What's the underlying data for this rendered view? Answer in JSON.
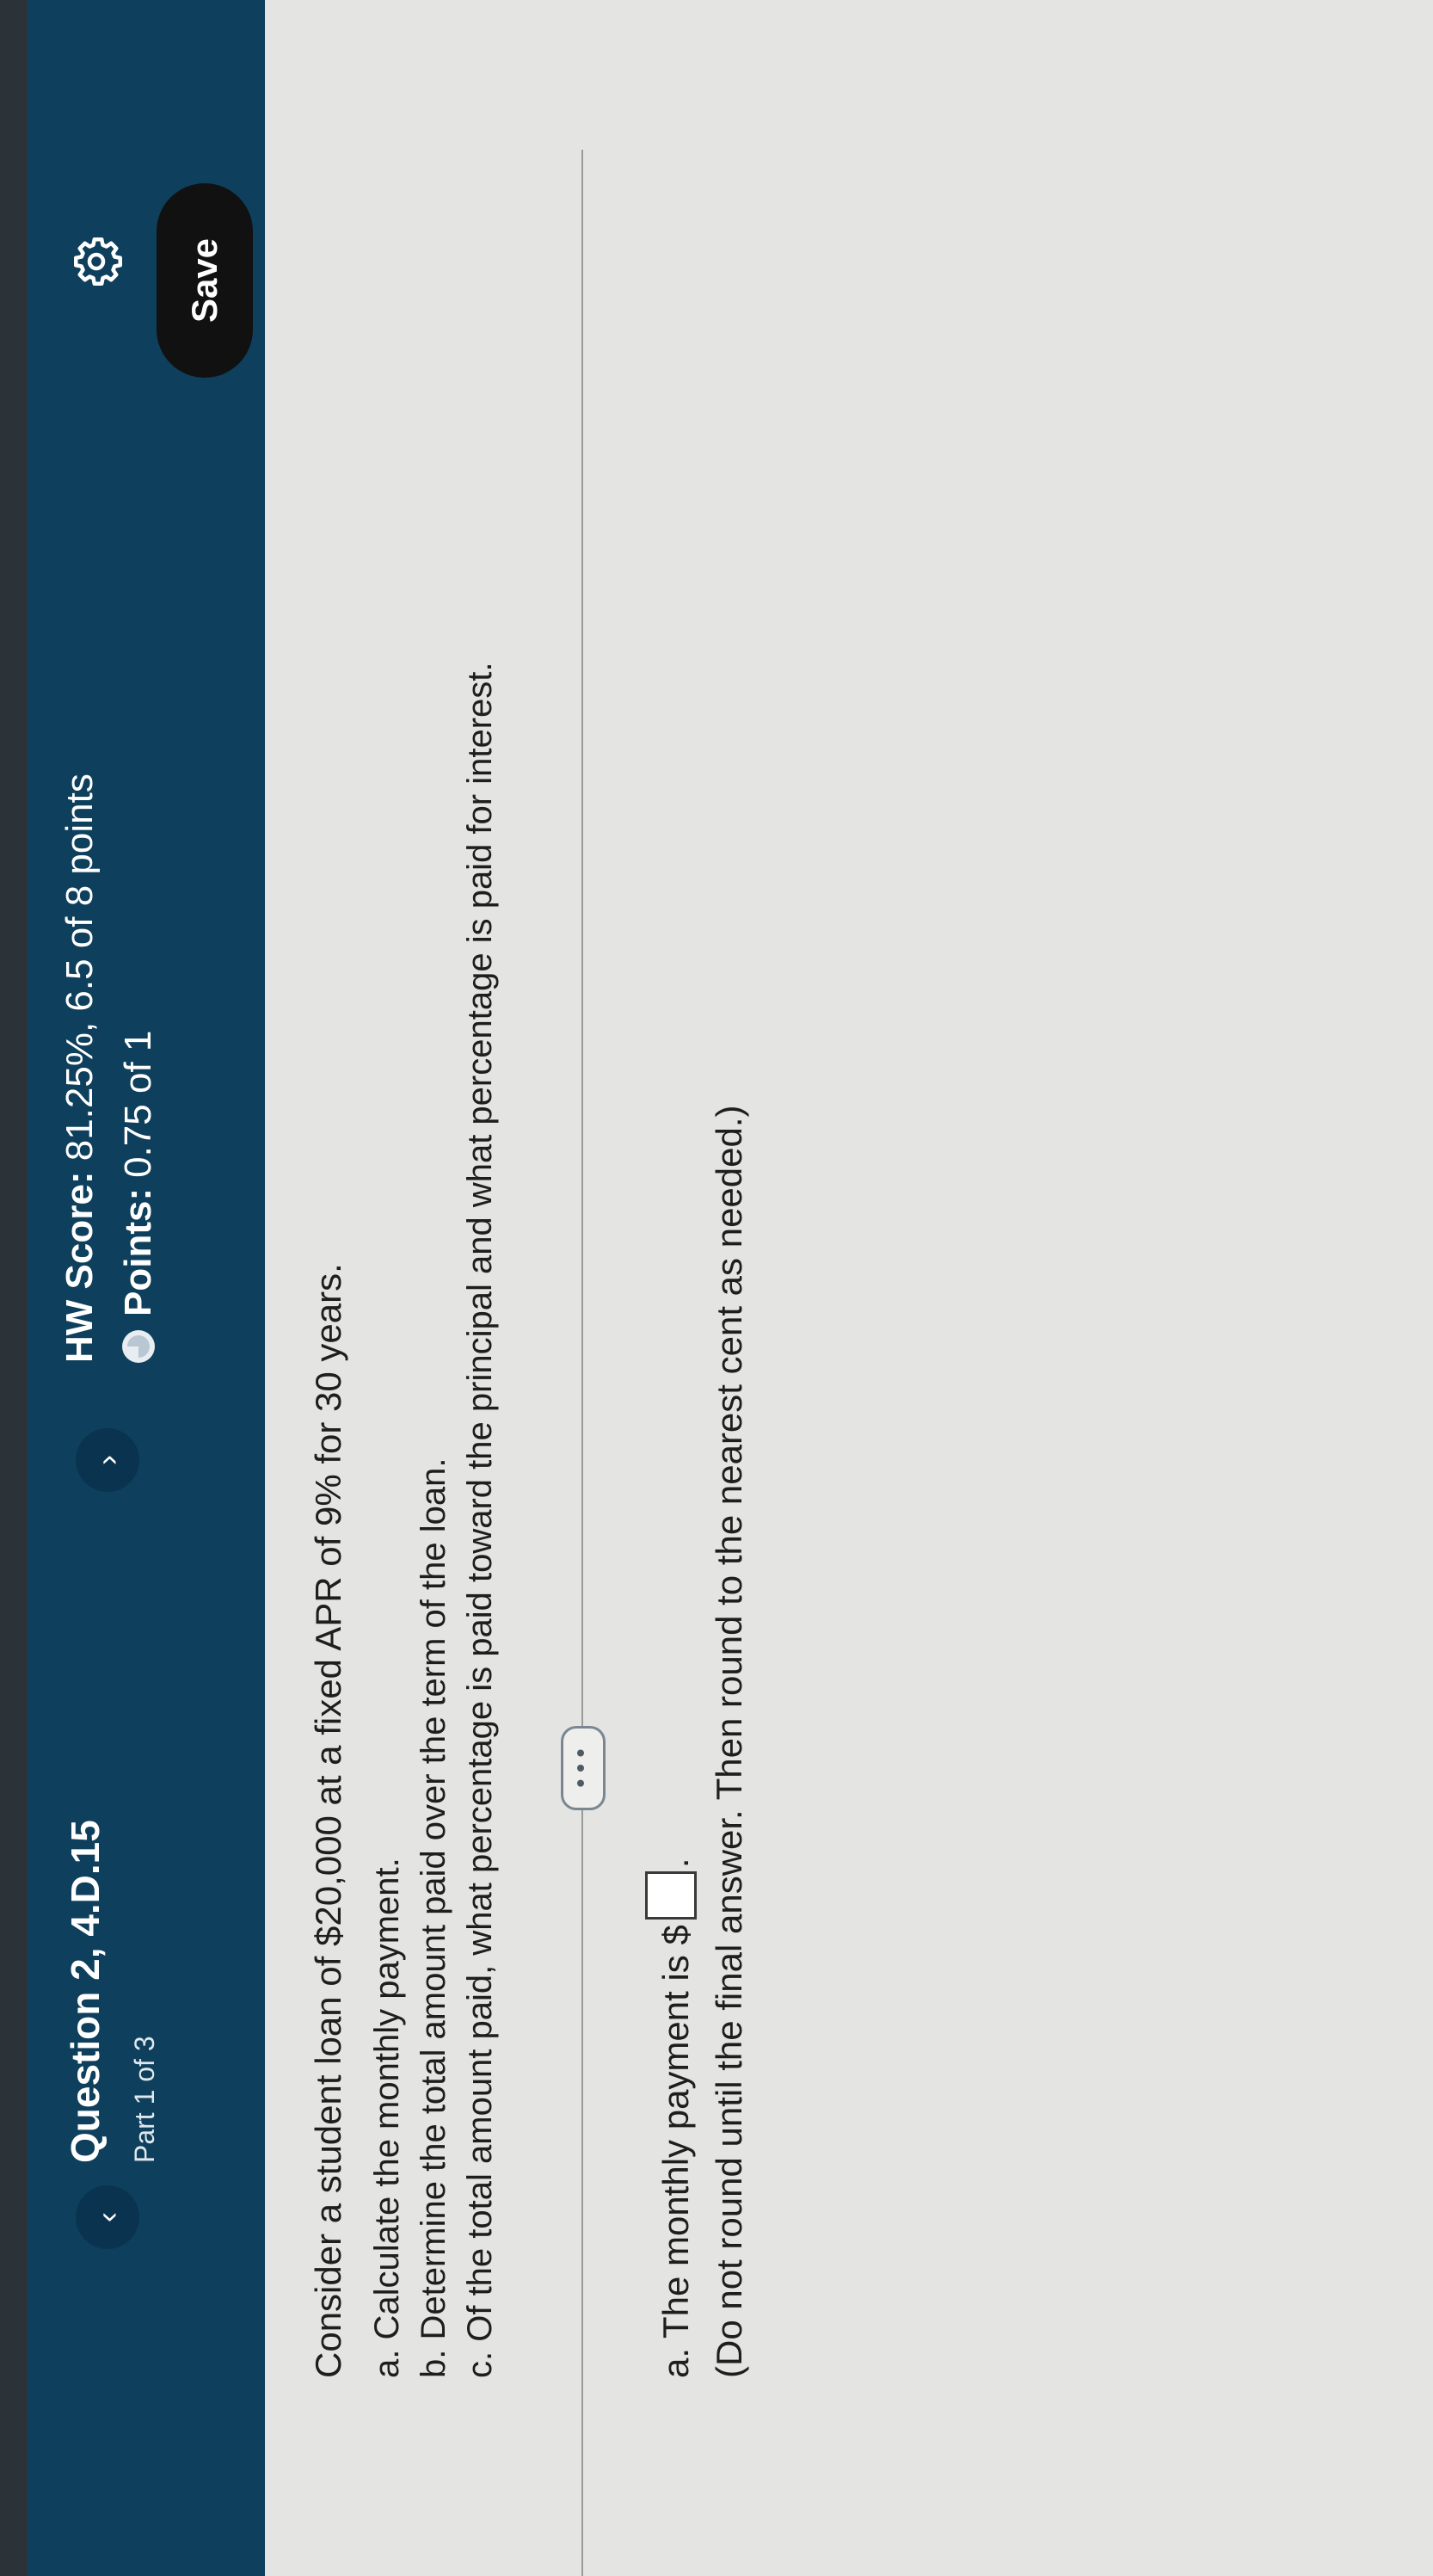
{
  "header": {
    "prev_icon": "chevron-left-icon",
    "next_icon": "chevron-right-icon",
    "prev_glyph": "‹",
    "next_glyph": "›",
    "question_title": "Question 2, 4.D.15",
    "part_label": "Part 1 of 3",
    "hw_score_label": "HW Score:",
    "hw_score_value": "81.25%, 6.5 of 8 points",
    "points_label": "Points:",
    "points_value": "0.75 of 1",
    "points_icon": "partial-credit-icon",
    "save_label": "Save",
    "settings_icon": "gear-icon",
    "colors": {
      "header_bg": "#0e3f5c",
      "save_bg": "#111111"
    }
  },
  "question": {
    "stem": "Consider a student loan of $20,000 at a fixed APR of 9% for 30 years.",
    "parts": [
      "a. Calculate the monthly payment.",
      "b. Determine the total amount paid over the term of the loan.",
      "c. Of the total amount paid, what percentage is paid toward the principal and what percentage is paid for interest."
    ],
    "more_label": "• • •"
  },
  "answer": {
    "prompt_prefix": "a. The monthly payment is $",
    "prompt_suffix": ".",
    "input_value": "",
    "note": "(Do not round until the final answer. Then round to the nearest cent as needed.)"
  }
}
